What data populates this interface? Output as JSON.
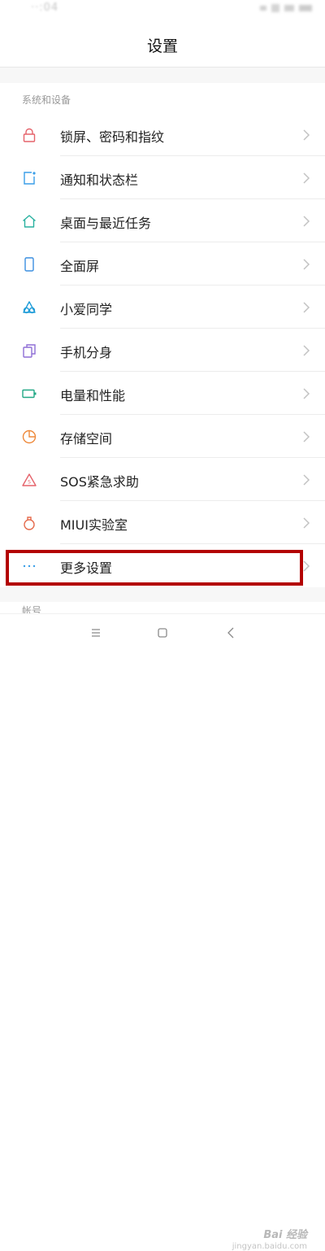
{
  "status": {
    "time": "··:04"
  },
  "header": {
    "title": "设置"
  },
  "section": {
    "label": "系统和设备",
    "items": [
      {
        "label": "锁屏、密码和指纹",
        "icon": "lock-icon",
        "color": "#e5636b"
      },
      {
        "label": "通知和状态栏",
        "icon": "notification-icon",
        "color": "#3a9ee8"
      },
      {
        "label": "桌面与最近任务",
        "icon": "home-icon",
        "color": "#2ab1a0"
      },
      {
        "label": "全面屏",
        "icon": "fullscreen-phone-icon",
        "color": "#3b8fe0"
      },
      {
        "label": "小爱同学",
        "icon": "xiaoai-icon",
        "color": "#1f9cd8"
      },
      {
        "label": "手机分身",
        "icon": "dual-space-icon",
        "color": "#8f6fd6"
      },
      {
        "label": "电量和性能",
        "icon": "battery-icon",
        "color": "#22a886"
      },
      {
        "label": "存储空间",
        "icon": "storage-pie-icon",
        "color": "#ee8a3c"
      },
      {
        "label": "SOS紧急求助",
        "icon": "sos-icon",
        "color": "#e5636b"
      },
      {
        "label": "MIUI实验室",
        "icon": "lab-flask-icon",
        "color": "#e56b4d"
      },
      {
        "label": "更多设置",
        "icon": "more-dots-icon",
        "color": "#3a9ee8"
      }
    ]
  },
  "section2": {
    "label": "帐号"
  },
  "watermark": {
    "brand": "Bai 经验",
    "sub": "jingyan.baidu.com"
  }
}
